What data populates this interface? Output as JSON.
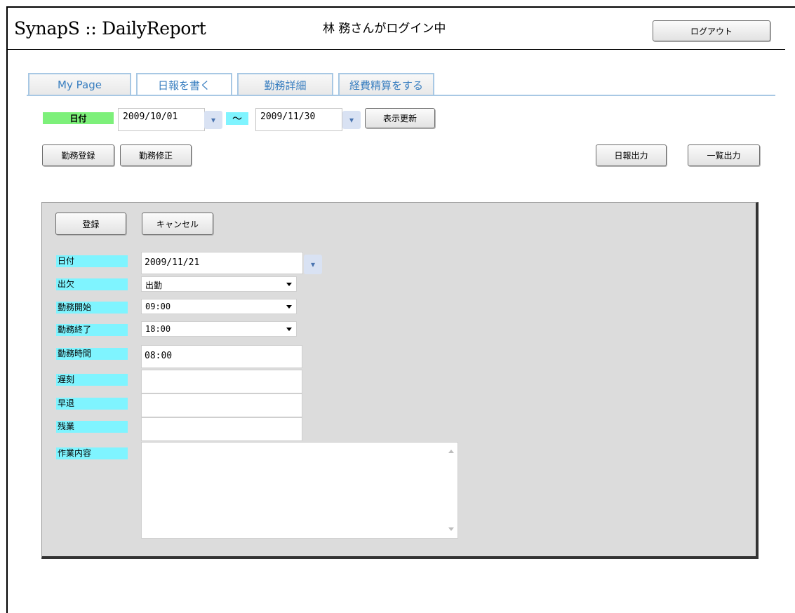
{
  "header": {
    "app_title": "SynapS :: DailyReport",
    "login_status": "林 務さんがログイン中",
    "logout_label": "ログアウト"
  },
  "tabs": [
    {
      "label": "My Page",
      "active": false
    },
    {
      "label": "日報を書く",
      "active": true
    },
    {
      "label": "勤務詳細",
      "active": false
    },
    {
      "label": "経費精算をする",
      "active": false
    }
  ],
  "filter": {
    "date_label": "日付",
    "from_date": "2009/10/01",
    "separator": "～",
    "to_date": "2009/11/30",
    "refresh_label": "表示更新"
  },
  "toolbar": {
    "register_work": "勤務登録",
    "edit_work": "勤務修正",
    "daily_report_output": "日報出力",
    "list_output": "一覧出力"
  },
  "form": {
    "save_label": "登録",
    "cancel_label": "キャンセル",
    "fields": {
      "date": {
        "label": "日付",
        "value": "2009/11/21"
      },
      "attendance": {
        "label": "出欠",
        "value": "出勤"
      },
      "start": {
        "label": "勤務開始",
        "value": "09:00"
      },
      "end": {
        "label": "勤務終了",
        "value": "18:00"
      },
      "hours": {
        "label": "勤務時間",
        "value": "08:00"
      },
      "late": {
        "label": "遅刻",
        "value": ""
      },
      "early_leave": {
        "label": "早退",
        "value": ""
      },
      "overtime": {
        "label": "残業",
        "value": ""
      },
      "work_content": {
        "label": "作業内容",
        "value": ""
      }
    }
  },
  "icons": {
    "dropdown": "chevron-down-icon"
  }
}
